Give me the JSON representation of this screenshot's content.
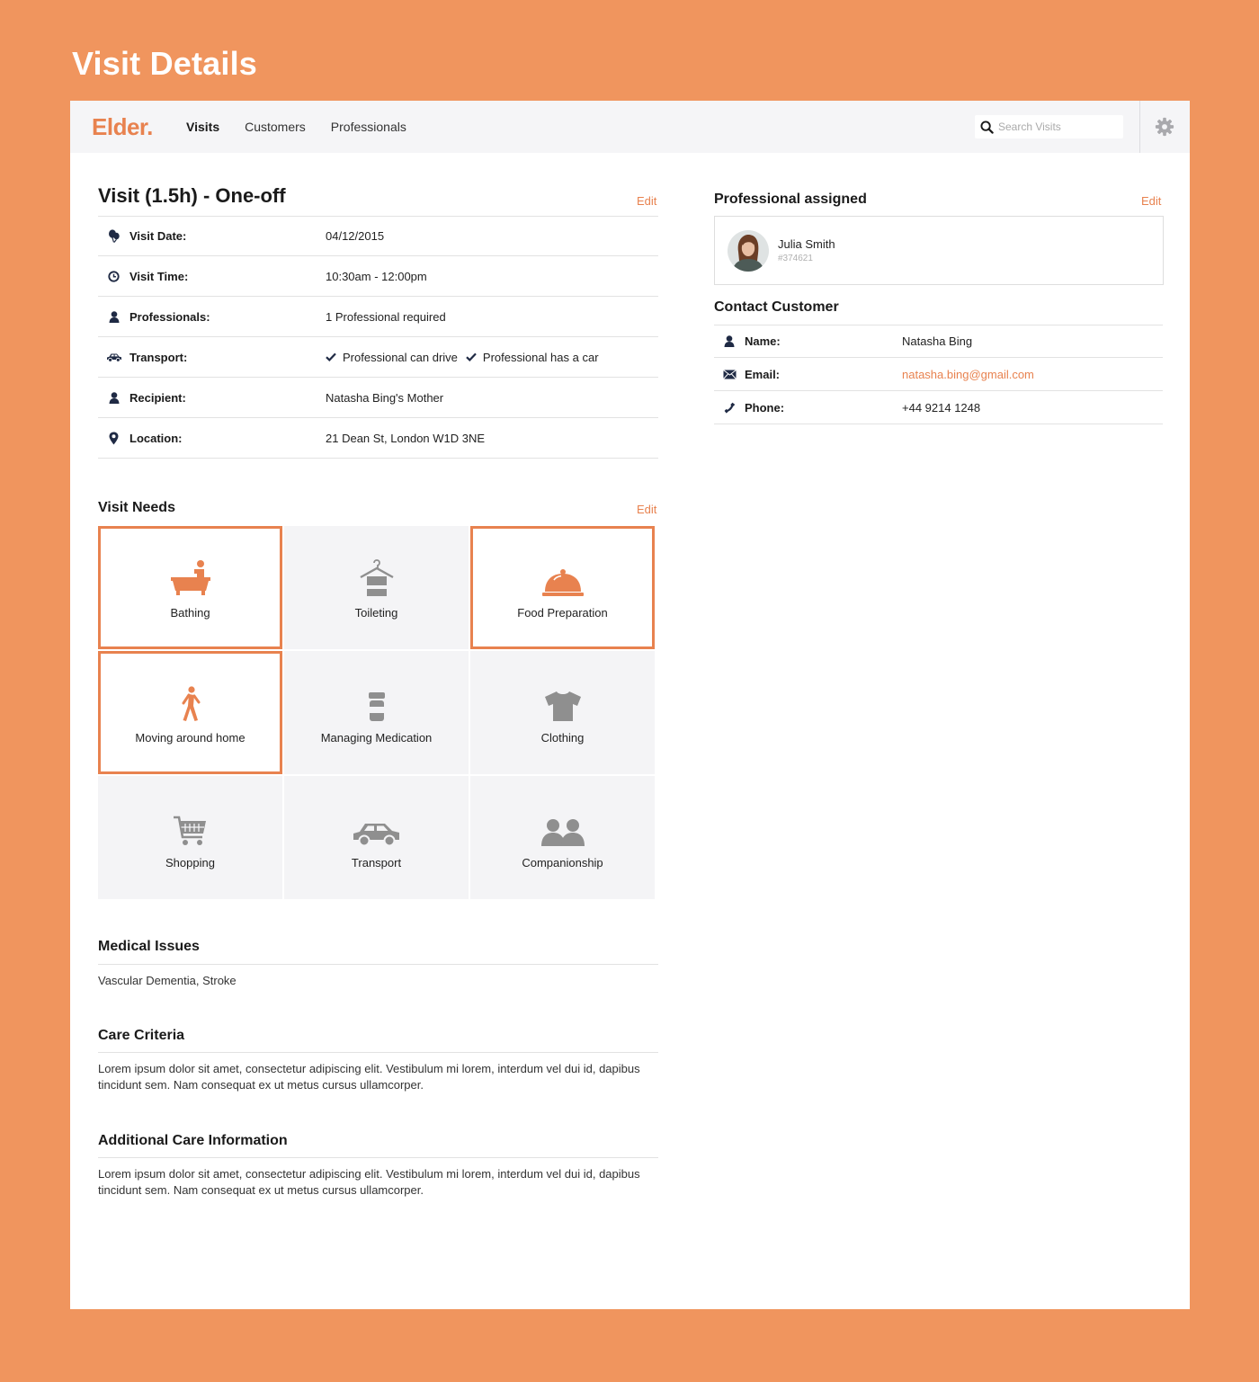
{
  "page": {
    "heading": "Visit Details"
  },
  "app": {
    "logo": "Elder.",
    "nav": [
      {
        "label": "Visits",
        "active": true
      },
      {
        "label": "Customers",
        "active": false
      },
      {
        "label": "Professionals",
        "active": false
      }
    ],
    "search": {
      "placeholder": "Search Visits",
      "value": ""
    },
    "settings_icon": "gear-icon"
  },
  "colors": {
    "accent": "#e8824f",
    "background": "#f0955e",
    "tile": "#f4f4f6",
    "icon_grey": "#8f8f8f",
    "icon_dark": "#1f2a44"
  },
  "visit": {
    "title": "Visit (1.5h) - One-off",
    "edit_label": "Edit",
    "details": [
      {
        "icon": "balloon-icon",
        "label": "Visit Date:",
        "value": "04/12/2015"
      },
      {
        "icon": "clock-icon",
        "label": "Visit Time:",
        "value": "10:30am - 12:00pm"
      },
      {
        "icon": "person-icon",
        "label": "Professionals:",
        "value": "1 Professional required"
      },
      {
        "icon": "car-icon",
        "label": "Transport:",
        "checks": [
          "Professional can drive",
          "Professional has a car"
        ]
      },
      {
        "icon": "person-icon",
        "label": "Recipient:",
        "value": "Natasha Bing's Mother"
      },
      {
        "icon": "location-pin-icon",
        "label": "Location:",
        "value": "21 Dean St, London W1D 3NE"
      }
    ]
  },
  "needs": {
    "title": "Visit Needs",
    "edit_label": "Edit",
    "items": [
      {
        "label": "Bathing",
        "icon": "bathtub-icon",
        "selected": true
      },
      {
        "label": "Toileting",
        "icon": "hanger-towel-icon",
        "selected": false
      },
      {
        "label": "Food Preparation",
        "icon": "food-cloche-icon",
        "selected": true
      },
      {
        "label": "Moving around home",
        "icon": "walking-icon",
        "selected": true
      },
      {
        "label": "Managing Medication",
        "icon": "pill-bottle-icon",
        "selected": false
      },
      {
        "label": "Clothing",
        "icon": "tshirt-icon",
        "selected": false
      },
      {
        "label": "Shopping",
        "icon": "shopping-cart-icon",
        "selected": false
      },
      {
        "label": "Transport",
        "icon": "car-icon",
        "selected": false
      },
      {
        "label": "Companionship",
        "icon": "two-people-icon",
        "selected": false
      }
    ]
  },
  "medical": {
    "title": "Medical Issues",
    "text": "Vascular Dementia, Stroke"
  },
  "care_criteria": {
    "title": "Care Criteria",
    "text": "Lorem ipsum dolor sit amet, consectetur adipiscing elit. Vestibulum mi lorem, interdum vel dui id, dapibus tincidunt sem. Nam consequat ex ut metus cursus ullamcorper."
  },
  "additional": {
    "title": "Additional Care Information",
    "text": "Lorem ipsum dolor sit amet, consectetur adipiscing elit. Vestibulum mi lorem, interdum vel dui id, dapibus tincidunt sem. Nam consequat ex ut metus cursus ullamcorper."
  },
  "professional": {
    "title": "Professional assigned",
    "edit_label": "Edit",
    "name": "Julia Smith",
    "id": "#374621"
  },
  "contact": {
    "title": "Contact Customer",
    "rows": [
      {
        "icon": "person-icon",
        "label": "Name:",
        "value": "Natasha Bing",
        "link": false
      },
      {
        "icon": "envelope-icon",
        "label": "Email:",
        "value": "natasha.bing@gmail.com",
        "link": true
      },
      {
        "icon": "phone-icon",
        "label": "Phone:",
        "value": "+44 9214 1248",
        "link": false
      }
    ]
  }
}
